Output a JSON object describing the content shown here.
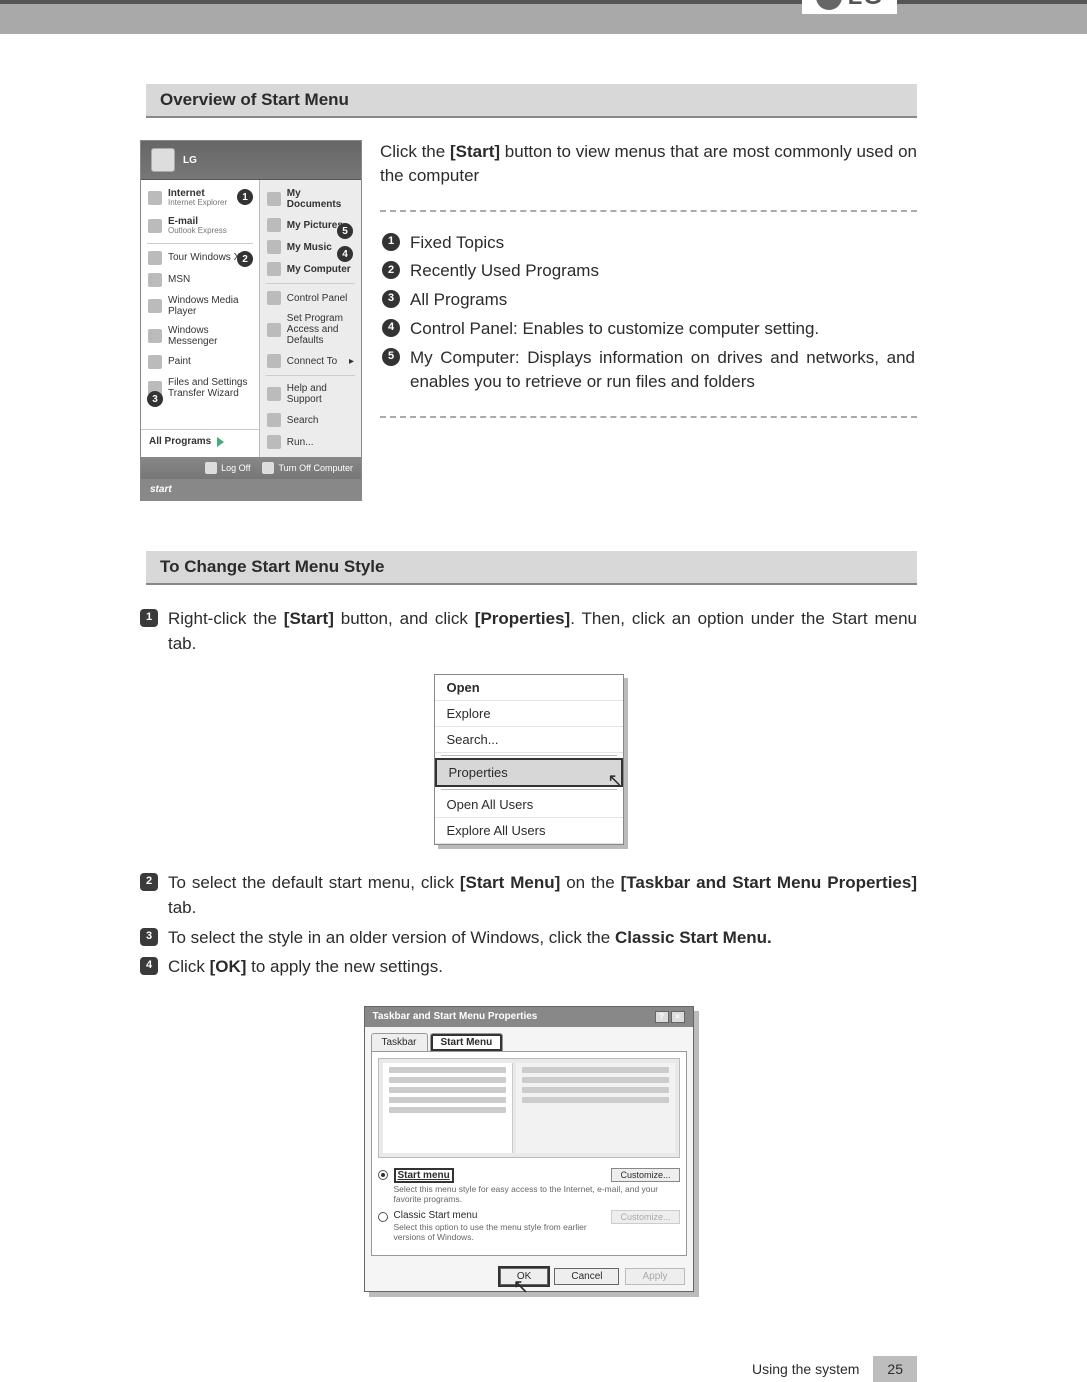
{
  "brand": "LG",
  "sections": {
    "overview_title": "Overview of Start Menu",
    "change_title": "To Change Start Menu Style"
  },
  "intro": "Click the [Start] button to view menus that are most commonly used on the computer",
  "callouts": {
    "i1": "Fixed Topics",
    "i2": "Recently Used Programs",
    "i3": "All Programs",
    "i4": "Control Panel: Enables to customize computer setting.",
    "i5": "My Computer: Displays information on drives and networks, and enables you to retrieve or run files and folders"
  },
  "start_menu": {
    "user": "LG",
    "left": {
      "internet_title": "Internet",
      "internet_sub": "Internet Explorer",
      "email_title": "E-mail",
      "email_sub": "Outlook Express",
      "tour": "Tour Windows XP",
      "msn": "MSN",
      "wmp": "Windows Media Player",
      "msgr": "Windows Messenger",
      "paint": "Paint",
      "fst": "Files and Settings Transfer Wizard",
      "all": "All Programs"
    },
    "right": {
      "docs": "My Documents",
      "pics": "My Pictures",
      "music": "My Music",
      "comp": "My Computer",
      "cpl": "Control Panel",
      "spad": "Set Program Access and Defaults",
      "conn": "Connect To",
      "help": "Help and Support",
      "search": "Search",
      "run": "Run..."
    },
    "logoff": "Log Off",
    "shutdown": "Turn Off Computer",
    "start": "start"
  },
  "steps": {
    "s1a": "Right-click the ",
    "s1b": "[Start]",
    "s1c": " button, and click ",
    "s1d": "[Properties]",
    "s1e": ". Then, click an option under the Start menu tab.",
    "s2a": "To select the default start menu, click ",
    "s2b": "[Start Menu]",
    "s2c": " on the ",
    "s2d": "[Taskbar and Start Menu Properties]",
    "s2e": " tab.",
    "s3a": "To select the style in an older version of Windows, click the ",
    "s3b": "Classic Start Menu.",
    "s4a": "Click ",
    "s4b": "[OK]",
    "s4c": " to apply the new settings."
  },
  "context_menu": {
    "open": "Open",
    "explore": "Explore",
    "search": "Search...",
    "properties": "Properties",
    "open_all": "Open All Users",
    "explore_all": "Explore All Users"
  },
  "dialog": {
    "title": "Taskbar and Start Menu Properties",
    "tab_taskbar": "Taskbar",
    "tab_startmenu": "Start Menu",
    "opt_start_label": "Start menu",
    "opt_start_desc": "Select this menu style for easy access to the Internet, e-mail, and your favorite programs.",
    "opt_classic_label": "Classic Start menu",
    "opt_classic_desc": "Select this option to use the menu style from earlier versions of Windows.",
    "customize": "Customize...",
    "ok": "OK",
    "cancel": "Cancel",
    "apply": "Apply"
  },
  "footer": {
    "label": "Using the system",
    "page": "25"
  }
}
